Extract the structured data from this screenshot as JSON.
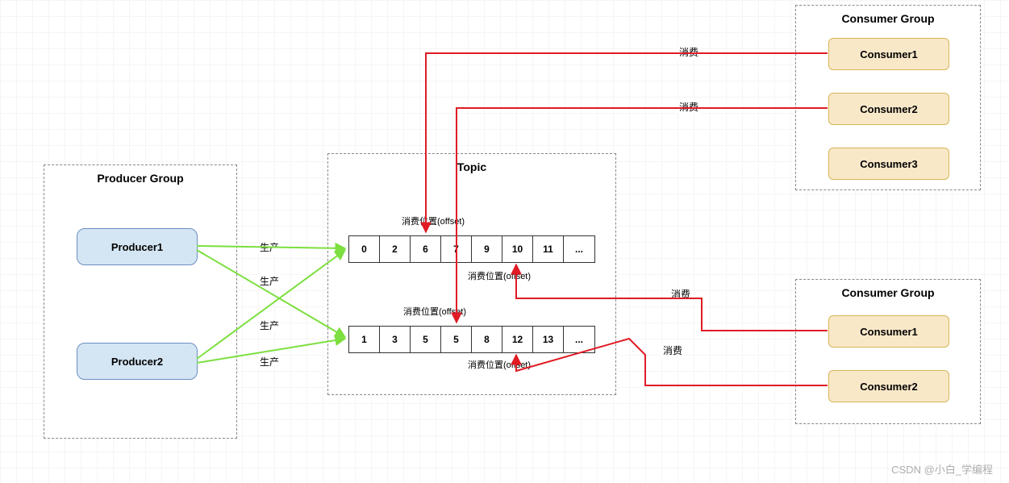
{
  "producer_group": {
    "title": "Producer Group",
    "items": [
      "Producer1",
      "Producer2"
    ]
  },
  "topic": {
    "title": "Topic",
    "queue1": [
      "0",
      "2",
      "6",
      "7",
      "9",
      "10",
      "11",
      "..."
    ],
    "queue2": [
      "1",
      "3",
      "5",
      "5",
      "8",
      "12",
      "13",
      "..."
    ],
    "offset_label": "消费位置(offset)"
  },
  "consumer_group_top": {
    "title": "Consumer Group",
    "items": [
      "Consumer1",
      "Consumer2",
      "Consumer3"
    ]
  },
  "consumer_group_bottom": {
    "title": "Consumer Group",
    "items": [
      "Consumer1",
      "Consumer2"
    ]
  },
  "labels": {
    "produce": "生产",
    "consume": "消费"
  },
  "watermark": "CSDN @小白_学编程"
}
